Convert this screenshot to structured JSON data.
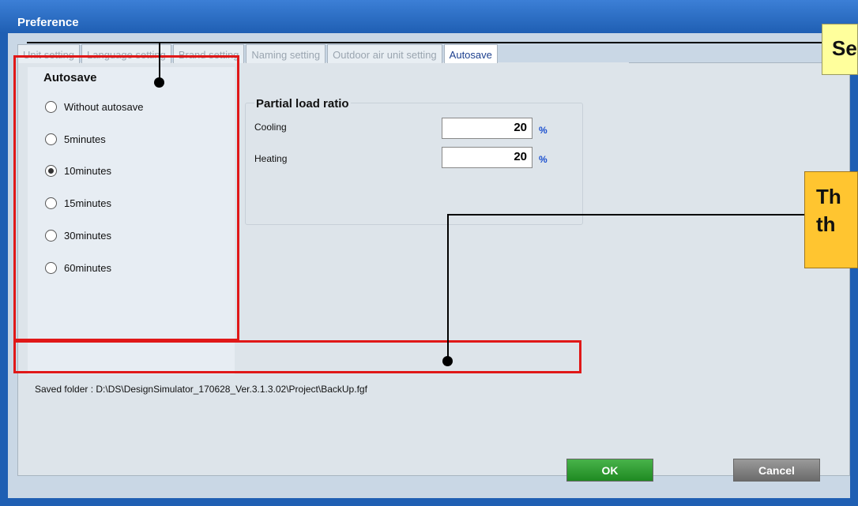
{
  "window": {
    "title": "Preference"
  },
  "tabs": [
    {
      "label": "Unit setting",
      "active": false
    },
    {
      "label": "Language setting",
      "active": false
    },
    {
      "label": "Brand setting",
      "active": false
    },
    {
      "label": "Naming setting",
      "active": false
    },
    {
      "label": "Outdoor air unit setting",
      "active": false
    },
    {
      "label": "Autosave",
      "active": true
    }
  ],
  "autosave": {
    "title": "Autosave",
    "options": [
      {
        "label": "Without autosave",
        "checked": false
      },
      {
        "label": "5minutes",
        "checked": false
      },
      {
        "label": "10minutes",
        "checked": true
      },
      {
        "label": "15minutes",
        "checked": false
      },
      {
        "label": "30minutes",
        "checked": false
      },
      {
        "label": "60minutes",
        "checked": false
      }
    ]
  },
  "partial_load": {
    "title": "Partial load ratio",
    "cooling": {
      "label": "Cooling",
      "value": "20",
      "unit": "%"
    },
    "heating": {
      "label": "Heating",
      "value": "20",
      "unit": "%"
    }
  },
  "saved_folder": "Saved folder : D:\\DS\\DesignSimulator_170628_Ver.3.1.3.02\\Project\\BackUp.fgf",
  "buttons": {
    "ok": "OK",
    "cancel": "Cancel"
  },
  "callouts": {
    "top_text": "Se",
    "mid_line1": "Th",
    "mid_line2": "th"
  },
  "colors": {
    "title_bar": "#1f5fb3",
    "ok_button": "#2e9b31",
    "highlight_box": "#e01818",
    "callout_yellow": "#ffff9c",
    "callout_orange": "#ffc530"
  }
}
